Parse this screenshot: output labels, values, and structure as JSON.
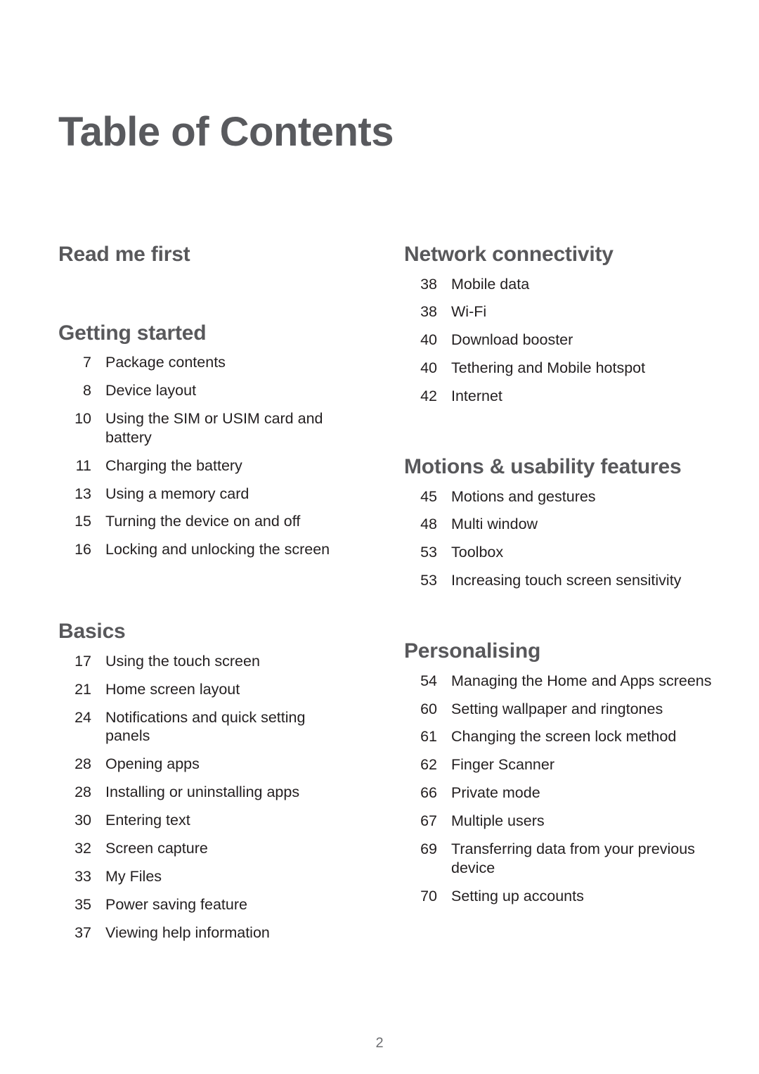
{
  "document": {
    "title": "Table of Contents",
    "page_number": "2"
  },
  "colors": {
    "heading": "#58585b",
    "title": "#595a5e",
    "body": "#231f20",
    "footer": "#6d6e71",
    "background": "#ffffff"
  },
  "columns": {
    "left": [
      {
        "heading": "Read me first",
        "entries": []
      },
      {
        "heading": "Getting started",
        "entries": [
          {
            "page": "7",
            "title": "Package contents"
          },
          {
            "page": "8",
            "title": "Device layout"
          },
          {
            "page": "10",
            "title": "Using the SIM or USIM card and battery"
          },
          {
            "page": "11",
            "title": "Charging the battery"
          },
          {
            "page": "13",
            "title": "Using a memory card"
          },
          {
            "page": "15",
            "title": "Turning the device on and off"
          },
          {
            "page": "16",
            "title": "Locking and unlocking the screen"
          }
        ]
      },
      {
        "heading": "Basics",
        "entries": [
          {
            "page": "17",
            "title": "Using the touch screen"
          },
          {
            "page": "21",
            "title": "Home screen layout"
          },
          {
            "page": "24",
            "title": "Notifications and quick setting panels"
          },
          {
            "page": "28",
            "title": "Opening apps"
          },
          {
            "page": "28",
            "title": "Installing or uninstalling apps"
          },
          {
            "page": "30",
            "title": "Entering text"
          },
          {
            "page": "32",
            "title": "Screen capture"
          },
          {
            "page": "33",
            "title": "My Files"
          },
          {
            "page": "35",
            "title": "Power saving feature"
          },
          {
            "page": "37",
            "title": "Viewing help information"
          }
        ]
      }
    ],
    "right": [
      {
        "heading": "Network connectivity",
        "entries": [
          {
            "page": "38",
            "title": "Mobile data"
          },
          {
            "page": "38",
            "title": "Wi-Fi"
          },
          {
            "page": "40",
            "title": "Download booster"
          },
          {
            "page": "40",
            "title": "Tethering and Mobile hotspot"
          },
          {
            "page": "42",
            "title": "Internet"
          }
        ]
      },
      {
        "heading": "Motions & usability features",
        "entries": [
          {
            "page": "45",
            "title": "Motions and gestures"
          },
          {
            "page": "48",
            "title": "Multi window"
          },
          {
            "page": "53",
            "title": "Toolbox"
          },
          {
            "page": "53",
            "title": "Increasing touch screen sensitivity"
          }
        ]
      },
      {
        "heading": "Personalising",
        "entries": [
          {
            "page": "54",
            "title": "Managing the Home and Apps screens"
          },
          {
            "page": "60",
            "title": "Setting wallpaper and ringtones"
          },
          {
            "page": "61",
            "title": "Changing the screen lock method"
          },
          {
            "page": "62",
            "title": "Finger Scanner"
          },
          {
            "page": "66",
            "title": "Private mode"
          },
          {
            "page": "67",
            "title": "Multiple users"
          },
          {
            "page": "69",
            "title": "Transferring data from your previous device"
          },
          {
            "page": "70",
            "title": "Setting up accounts"
          }
        ]
      }
    ]
  }
}
